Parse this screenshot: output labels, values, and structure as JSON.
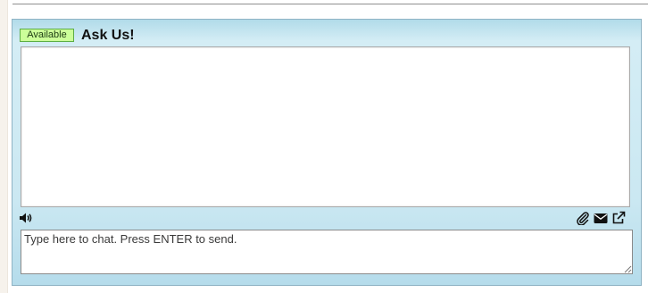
{
  "chat": {
    "status_label": "Available",
    "title": "Ask Us!",
    "transcript_messages": [],
    "input": {
      "value": "",
      "placeholder": "Type here to chat. Press ENTER to send."
    },
    "toolbar": {
      "left_icons": [
        "sound-icon"
      ],
      "right_icons": [
        "paperclip-icon",
        "envelope-icon",
        "external-link-icon"
      ]
    }
  },
  "colors": {
    "status_background": "#ccff99",
    "status_border": "#5cad45",
    "panel_background": "#c8e7f1",
    "panel_border": "#8fb3c4"
  }
}
